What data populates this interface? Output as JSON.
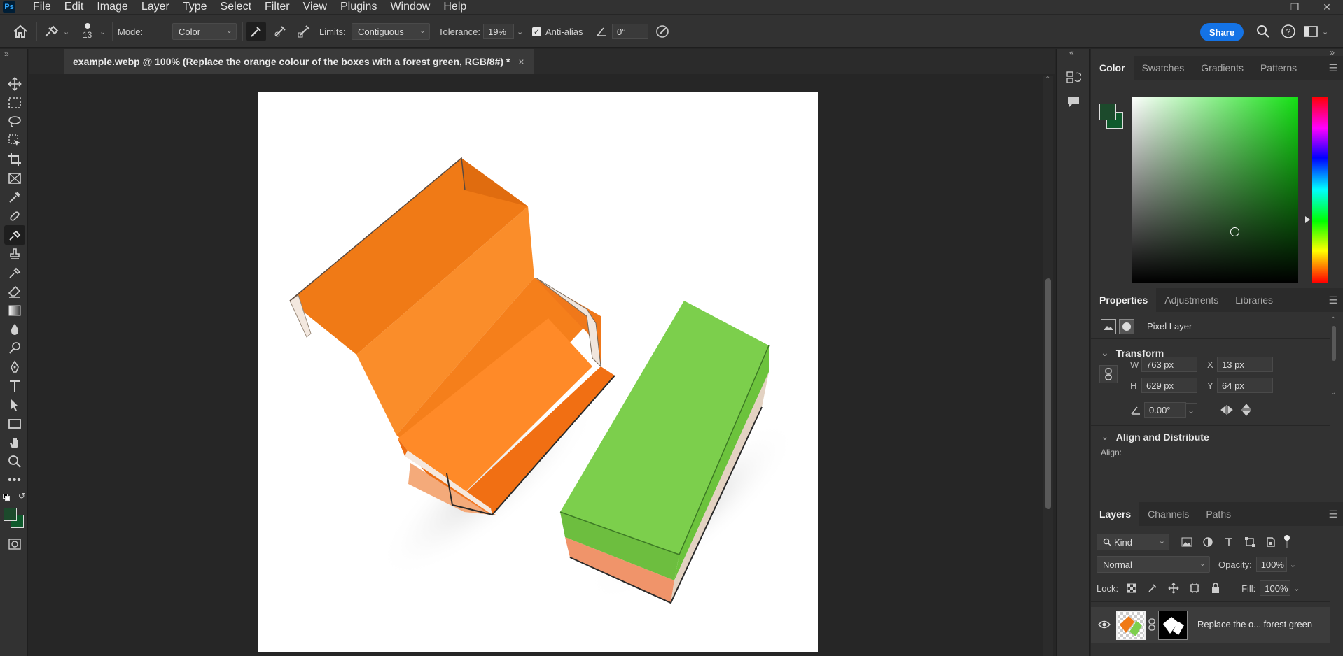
{
  "app": {
    "logo": "Ps"
  },
  "menu": [
    "File",
    "Edit",
    "Image",
    "Layer",
    "Type",
    "Select",
    "Filter",
    "View",
    "Plugins",
    "Window",
    "Help"
  ],
  "window_controls": {
    "minimize": "—",
    "restore": "❐",
    "close": "✕"
  },
  "options_bar": {
    "brush_size": "13",
    "mode_label": "Mode:",
    "mode_value": "Color",
    "limits_label": "Limits:",
    "limits_value": "Contiguous",
    "tolerance_label": "Tolerance:",
    "tolerance_value": "19%",
    "antialias_label": "Anti-alias",
    "antialias_checked": true,
    "angle_value": "0°",
    "share_label": "Share"
  },
  "document": {
    "tab_title": "example.webp @ 100% (Replace the orange colour of the boxes with a forest green, RGB/8#) *",
    "tab_close": "×"
  },
  "color_panel": {
    "tabs": [
      "Color",
      "Swatches",
      "Gradients",
      "Patterns"
    ],
    "active_tab": "Color",
    "foreground": "#1c4a2c",
    "background": "#0e5a2c",
    "saturation": 0.62,
    "brightness": 0.27,
    "hue_level": 0.66
  },
  "properties_panel": {
    "tabs": [
      "Properties",
      "Adjustments",
      "Libraries"
    ],
    "active_tab": "Properties",
    "layer_type": "Pixel Layer",
    "transform_title": "Transform",
    "w_label": "W",
    "w_value": "763 px",
    "h_label": "H",
    "h_value": "629 px",
    "x_label": "X",
    "x_value": "13 px",
    "y_label": "Y",
    "y_value": "64 px",
    "angle_value": "0.00°",
    "align_title": "Align and Distribute",
    "align_label": "Align:"
  },
  "layers_panel": {
    "tabs": [
      "Layers",
      "Channels",
      "Paths"
    ],
    "active_tab": "Layers",
    "filter_kind": "Kind",
    "blend_mode": "Normal",
    "opacity_label": "Opacity:",
    "opacity_value": "100%",
    "lock_label": "Lock:",
    "fill_label": "Fill:",
    "fill_value": "100%",
    "layer_name": "Replace the o... forest green"
  }
}
